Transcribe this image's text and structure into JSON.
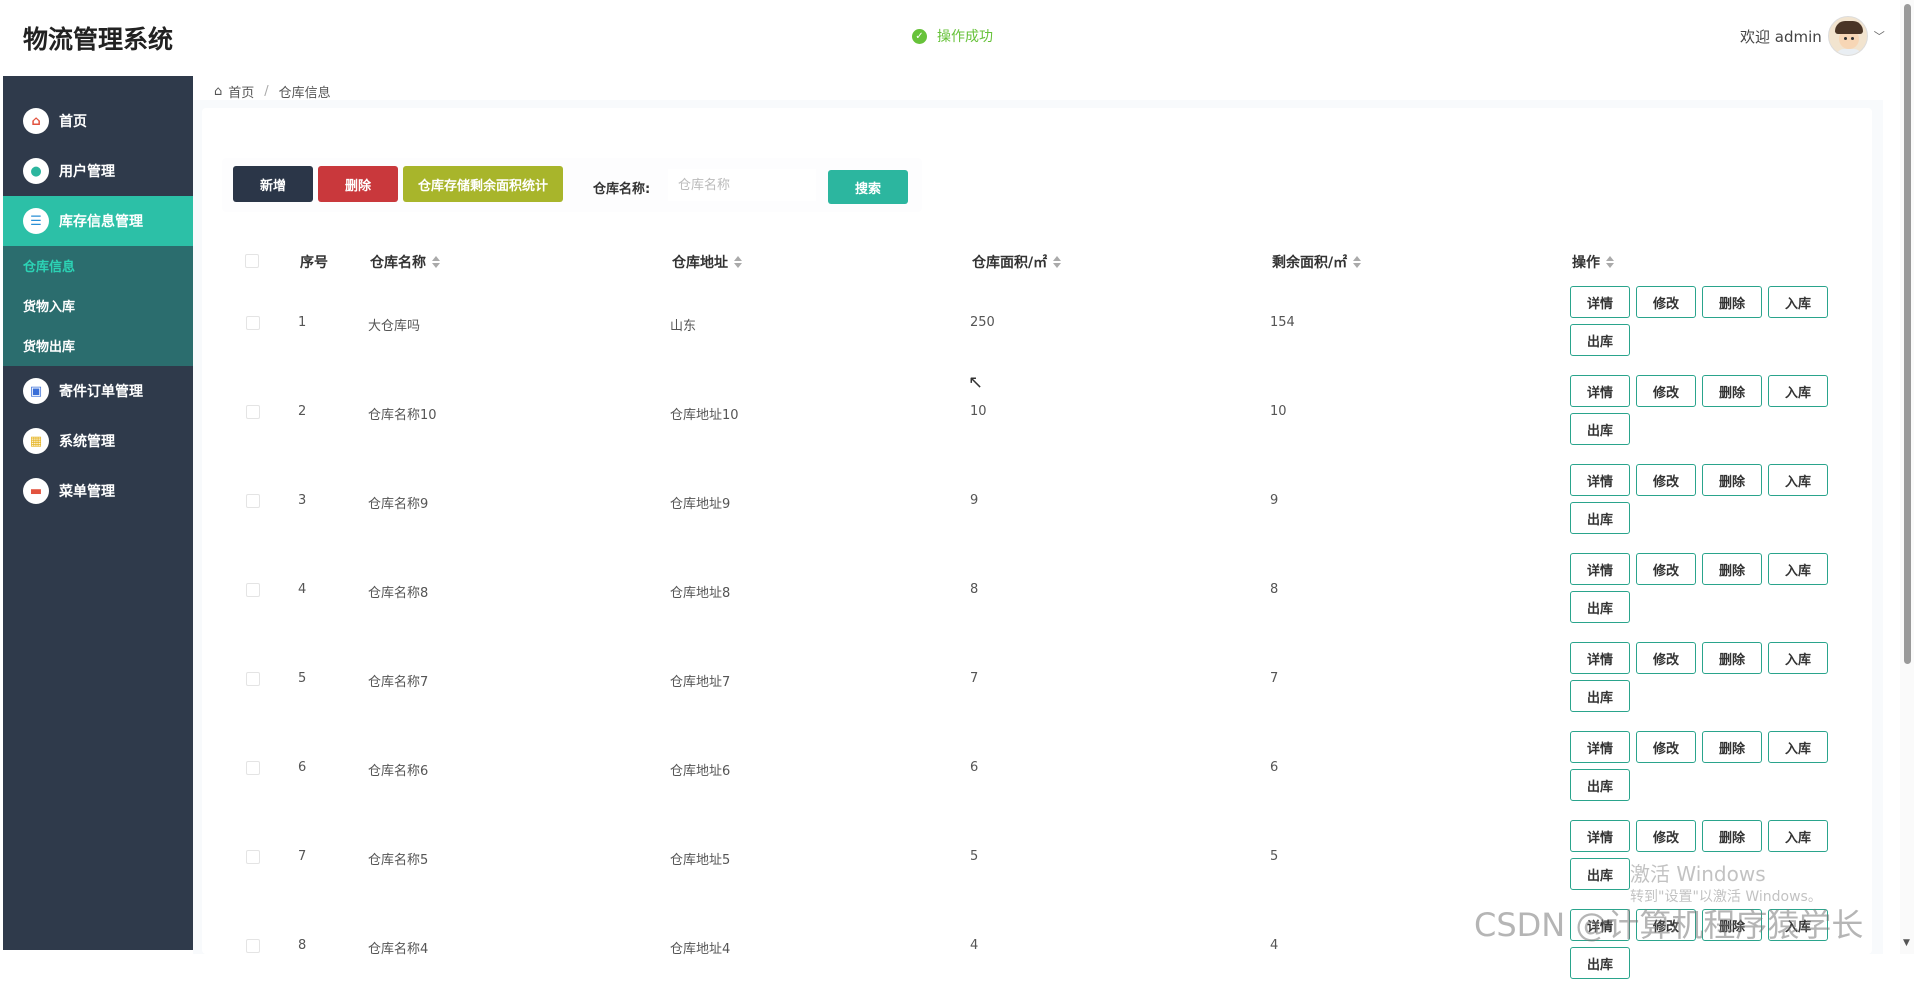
{
  "app": {
    "title": "物流管理系统"
  },
  "toast": {
    "message": "操作成功"
  },
  "user": {
    "greeting": "欢迎 admin"
  },
  "sidebar": {
    "items": [
      {
        "label": "首页",
        "icon": "home-icon"
      },
      {
        "label": "用户管理",
        "icon": "user-icon"
      },
      {
        "label": "库存信息管理",
        "icon": "inventory-icon"
      },
      {
        "label": "寄件订单管理",
        "icon": "order-icon"
      },
      {
        "label": "系统管理",
        "icon": "grid-icon"
      },
      {
        "label": "菜单管理",
        "icon": "menu-icon"
      }
    ],
    "submenu": [
      "仓库信息",
      "货物入库",
      "货物出库"
    ]
  },
  "breadcrumb": {
    "home": "首页",
    "current": "仓库信息"
  },
  "toolbar": {
    "add": "新增",
    "delete": "删除",
    "stats": "仓库存储剩余面积统计",
    "search_label": "仓库名称:",
    "search_placeholder": "仓库名称",
    "search": "搜索"
  },
  "table": {
    "columns": [
      "序号",
      "仓库名称",
      "仓库地址",
      "仓库面积/㎡",
      "剩余面积/㎡",
      "操作"
    ],
    "actions": [
      "详情",
      "修改",
      "删除",
      "入库",
      "出库"
    ],
    "rows": [
      {
        "idx": "1",
        "name": "大仓库吗",
        "addr": "山东",
        "area": "250",
        "remain": "154"
      },
      {
        "idx": "2",
        "name": "仓库名称10",
        "addr": "仓库地址10",
        "area": "10",
        "remain": "10"
      },
      {
        "idx": "3",
        "name": "仓库名称9",
        "addr": "仓库地址9",
        "area": "9",
        "remain": "9"
      },
      {
        "idx": "4",
        "name": "仓库名称8",
        "addr": "仓库地址8",
        "area": "8",
        "remain": "8"
      },
      {
        "idx": "5",
        "name": "仓库名称7",
        "addr": "仓库地址7",
        "area": "7",
        "remain": "7"
      },
      {
        "idx": "6",
        "name": "仓库名称6",
        "addr": "仓库地址6",
        "area": "6",
        "remain": "6"
      },
      {
        "idx": "7",
        "name": "仓库名称5",
        "addr": "仓库地址5",
        "area": "5",
        "remain": "5"
      },
      {
        "idx": "8",
        "name": "仓库名称4",
        "addr": "仓库地址4",
        "area": "4",
        "remain": "4"
      }
    ]
  },
  "watermark": {
    "activate": "激活 Windows",
    "activate_hint": "转到\"设置\"以激活 Windows。",
    "csdn": "CSDN @计算机程序猿学长"
  }
}
